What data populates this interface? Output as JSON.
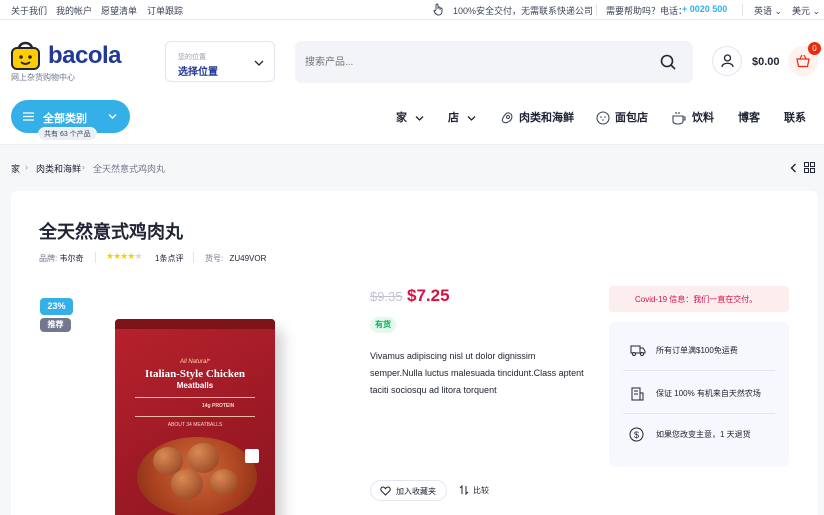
{
  "topbar": {
    "links": [
      "关于我们",
      "我的帐户",
      "愿望清单",
      "订单跟踪"
    ],
    "delivery_notice": "100%安全交付，无需联系快递公司",
    "help_label": "需要帮助吗？电话：",
    "phone": "+ 0020 500",
    "language": "英语",
    "currency": "美元"
  },
  "brand": {
    "name": "bacola",
    "tagline": "网上杂货购物中心"
  },
  "location": {
    "label": "您的位置",
    "value": "选择位置"
  },
  "search": {
    "placeholder": "搜索产品..."
  },
  "cart": {
    "total": "$0.00",
    "count": "0"
  },
  "categories_button": {
    "label": "全部类别",
    "count_label": "共有 63 个产品"
  },
  "nav": {
    "items": [
      "家",
      "店",
      "肉类和海鲜",
      "面包店",
      "饮料",
      "博客",
      "联系"
    ]
  },
  "breadcrumb": {
    "items": [
      "家",
      "肉类和海鲜",
      "全天然意式鸡肉丸"
    ]
  },
  "product": {
    "title": "全天然意式鸡肉丸",
    "brand_label": "品牌:",
    "brand": "韦尔奇",
    "rating": 4,
    "reviews": "1条点评",
    "sku_label": "货号:",
    "sku": "ZU49VOR",
    "discount_badge": "23%",
    "recommend_badge": "推荐",
    "old_price": "$9.35",
    "new_price": "$7.25",
    "stock": "有货",
    "description": "Vivamus adipiscing nisl ut dolor dignissim semper.Nulla luctus malesuada tincidunt.Class aptent taciti sociosqu ad litora torquent",
    "wishlist_label": "加入收藏夹",
    "compare_label": "比较",
    "package": {
      "line1": "All Natural*",
      "line2": "Italian-Style Chicken",
      "line3": "Meatballs",
      "line4": "ABOUT 34 MEATBALLS",
      "line5": "14g PROTEIN"
    }
  },
  "notice": {
    "text": "Covid-19 信息：我们一直在交付。"
  },
  "features": [
    {
      "icon": "delivery-truck-icon",
      "text": "所有订单满$100免运费"
    },
    {
      "icon": "organic-box-icon",
      "text": "保证 100% 有机来自天然农场"
    },
    {
      "icon": "money-back-icon",
      "text": "如果您改变主意，1 天退货"
    }
  ],
  "colors": {
    "accent_blue": "#35afe8",
    "price_red": "#d51243",
    "stock_green": "#00b853",
    "phone_blue": "#35afe8"
  }
}
